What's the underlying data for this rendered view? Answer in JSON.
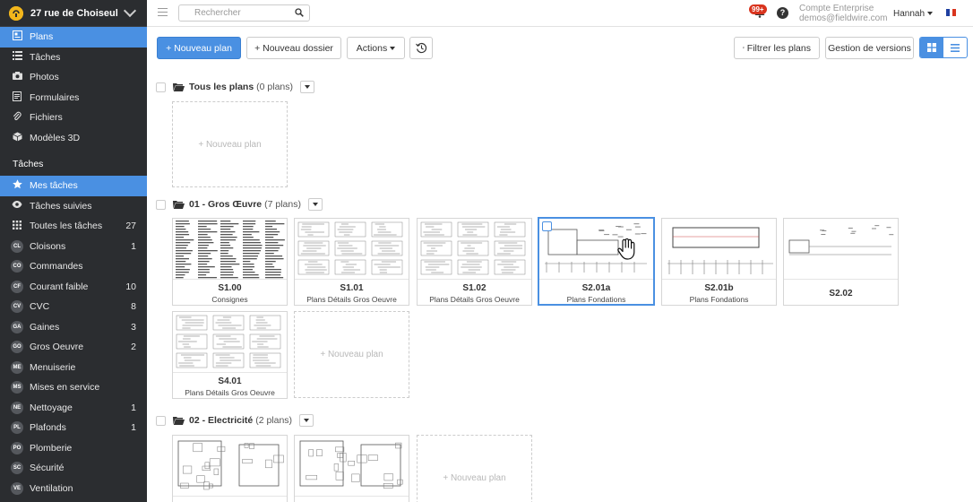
{
  "project": {
    "name": "27 rue de Choiseul",
    "logo": "fieldwire-logo"
  },
  "nav": [
    {
      "label": "Plans",
      "icon": "plans-icon",
      "active": true
    },
    {
      "label": "Tâches",
      "icon": "tasks-icon"
    },
    {
      "label": "Photos",
      "icon": "camera-icon"
    },
    {
      "label": "Formulaires",
      "icon": "forms-icon"
    },
    {
      "label": "Fichiers",
      "icon": "paperclip-icon"
    },
    {
      "label": "Modèles 3D",
      "icon": "cube-icon"
    }
  ],
  "tasks_section": {
    "title": "Tâches",
    "items": [
      {
        "label": "Mes tâches",
        "icon": "star-icon",
        "count": "",
        "active": true
      },
      {
        "label": "Tâches suivies",
        "icon": "eye-icon",
        "count": ""
      },
      {
        "label": "Toutes les tâches",
        "icon": "grid-icon",
        "count": "27"
      },
      {
        "label": "Cloisons",
        "code": "CL",
        "count": "1"
      },
      {
        "label": "Commandes",
        "code": "CO",
        "count": ""
      },
      {
        "label": "Courant faible",
        "code": "CF",
        "count": "10"
      },
      {
        "label": "CVC",
        "code": "CV",
        "count": "8"
      },
      {
        "label": "Gaines",
        "code": "GA",
        "count": "3"
      },
      {
        "label": "Gros Oeuvre",
        "code": "GO",
        "count": "2"
      },
      {
        "label": "Menuiserie",
        "code": "ME",
        "count": ""
      },
      {
        "label": "Mises en service",
        "code": "MS",
        "count": ""
      },
      {
        "label": "Nettoyage",
        "code": "NE",
        "count": "1"
      },
      {
        "label": "Plafonds",
        "code": "PL",
        "count": "1"
      },
      {
        "label": "Plomberie",
        "code": "PO",
        "count": ""
      },
      {
        "label": "Sécurité",
        "code": "SC",
        "count": ""
      },
      {
        "label": "Ventilation",
        "code": "VE",
        "count": ""
      }
    ]
  },
  "topbar": {
    "search_placeholder": "Rechercher",
    "notif_count": "99+",
    "help": "?",
    "account_type": "Compte Enterprise",
    "account_email": "demos@fieldwire.com",
    "user_name": "Hannah",
    "lang_flag": "fr"
  },
  "toolbar": {
    "new_plan": "+ Nouveau plan",
    "new_folder": "+ Nouveau dossier",
    "actions": "Actions",
    "filter": "Filtrer les plans",
    "versions": "Gestion de versions"
  },
  "folders": [
    {
      "name": "Tous les plans",
      "count": "(0 plans)"
    },
    {
      "name": "01 - Gros Œuvre",
      "count": "(7 plans)"
    },
    {
      "name": "02 - Electricité",
      "count": "(2 plans)"
    }
  ],
  "new_plan_label": "+ Nouveau plan",
  "plans": [
    {
      "code": "S1.00",
      "name": "Consignes"
    },
    {
      "code": "S1.01",
      "name": "Plans Détails Gros Oeuvre"
    },
    {
      "code": "S1.02",
      "name": "Plans Détails Gros Oeuvre"
    },
    {
      "code": "S2.01a",
      "name": "Plans Fondations"
    },
    {
      "code": "S2.01b",
      "name": "Plans Fondations"
    },
    {
      "code": "S2.02",
      "name": ""
    },
    {
      "code": "S4.01",
      "name": "Plans Détails Gros Oeuvre"
    }
  ],
  "colors": {
    "accent": "#4a90e2",
    "sidebar": "#2b2d30",
    "badge_red": "#d9341e",
    "logo_yellow": "#f2b61c"
  }
}
